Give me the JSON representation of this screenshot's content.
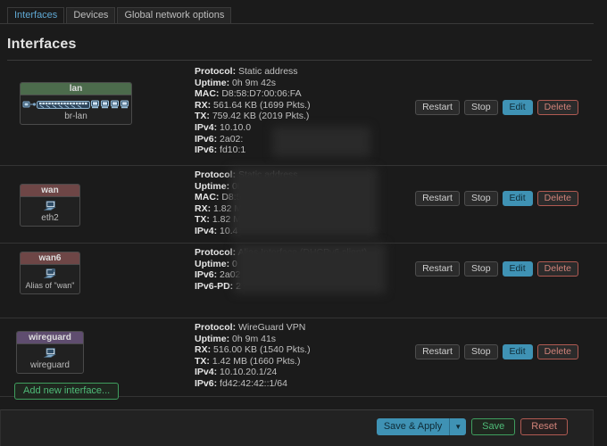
{
  "tabs": [
    {
      "label": "Interfaces",
      "active": true
    },
    {
      "label": "Devices",
      "active": false
    },
    {
      "label": "Global network options",
      "active": false
    }
  ],
  "page": {
    "title": "Interfaces"
  },
  "row_actions": {
    "restart": "Restart",
    "stop": "Stop",
    "edit": "Edit",
    "delete": "Delete"
  },
  "interfaces": [
    {
      "name": "lan",
      "device": "br-lan",
      "color": "lan",
      "icon": "bridge-icon",
      "details": [
        {
          "label": "Protocol:",
          "value": "Static address"
        },
        {
          "label": "Uptime:",
          "value": "0h 9m 42s"
        },
        {
          "label": "MAC:",
          "value": "D8:58:D7:00:06:FA"
        },
        {
          "label": "RX:",
          "value": "561.64 KB (1699 Pkts.)"
        },
        {
          "label": "TX:",
          "value": "759.42 KB (2019 Pkts.)"
        },
        {
          "label": "IPv4:",
          "value": "10.10.0"
        },
        {
          "label": "IPv6:",
          "value": "2a02:"
        },
        {
          "label": "IPv6:",
          "value": "fd10:1"
        }
      ]
    },
    {
      "name": "wan",
      "device": "eth2",
      "color": "wan",
      "icon": "ethernet-icon",
      "details": [
        {
          "label": "Protocol:",
          "value": "Static address"
        },
        {
          "label": "Uptime:",
          "value": "0h 9m 42s"
        },
        {
          "label": "MAC:",
          "value": "D8:5"
        },
        {
          "label": "RX:",
          "value": "1.82 M"
        },
        {
          "label": "TX:",
          "value": "1.82 M"
        },
        {
          "label": "IPv4:",
          "value": "10.4"
        }
      ]
    },
    {
      "name": "wan6",
      "device": "Alias of \"wan\"",
      "color": "wan",
      "icon": "alias-icon",
      "details": [
        {
          "label": "Protocol:",
          "value": "Alias Interface (DHCPv6 client)"
        },
        {
          "label": "Uptime:",
          "value": "0"
        },
        {
          "label": "IPv6:",
          "value": "2a02"
        },
        {
          "label": "IPv6-PD:",
          "value": "2"
        }
      ]
    },
    {
      "name": "wireguard",
      "device": "wireguard",
      "color": "wg",
      "icon": "ethernet-icon",
      "details": [
        {
          "label": "Protocol:",
          "value": "WireGuard VPN"
        },
        {
          "label": "Uptime:",
          "value": "0h 9m 41s"
        },
        {
          "label": "RX:",
          "value": "516.00 KB (1540 Pkts.)"
        },
        {
          "label": "TX:",
          "value": "1.42 MB (1660 Pkts.)"
        },
        {
          "label": "IPv4:",
          "value": "10.10.20.1/24"
        },
        {
          "label": "IPv6:",
          "value": "fd42:42:42::1/64"
        }
      ]
    }
  ],
  "add_button": {
    "label": "Add new interface..."
  },
  "footer": {
    "save_apply": "Save & Apply",
    "caret": "▼",
    "save": "Save",
    "reset": "Reset"
  },
  "colors": {
    "accent_blue": "#3f92b4",
    "green": "#3f9e5e",
    "red": "#b05a52",
    "lan_header": "#4c6b4c",
    "wan_header": "#6e4646",
    "wg_header": "#5f4d6f",
    "background": "#1b1b1b"
  }
}
